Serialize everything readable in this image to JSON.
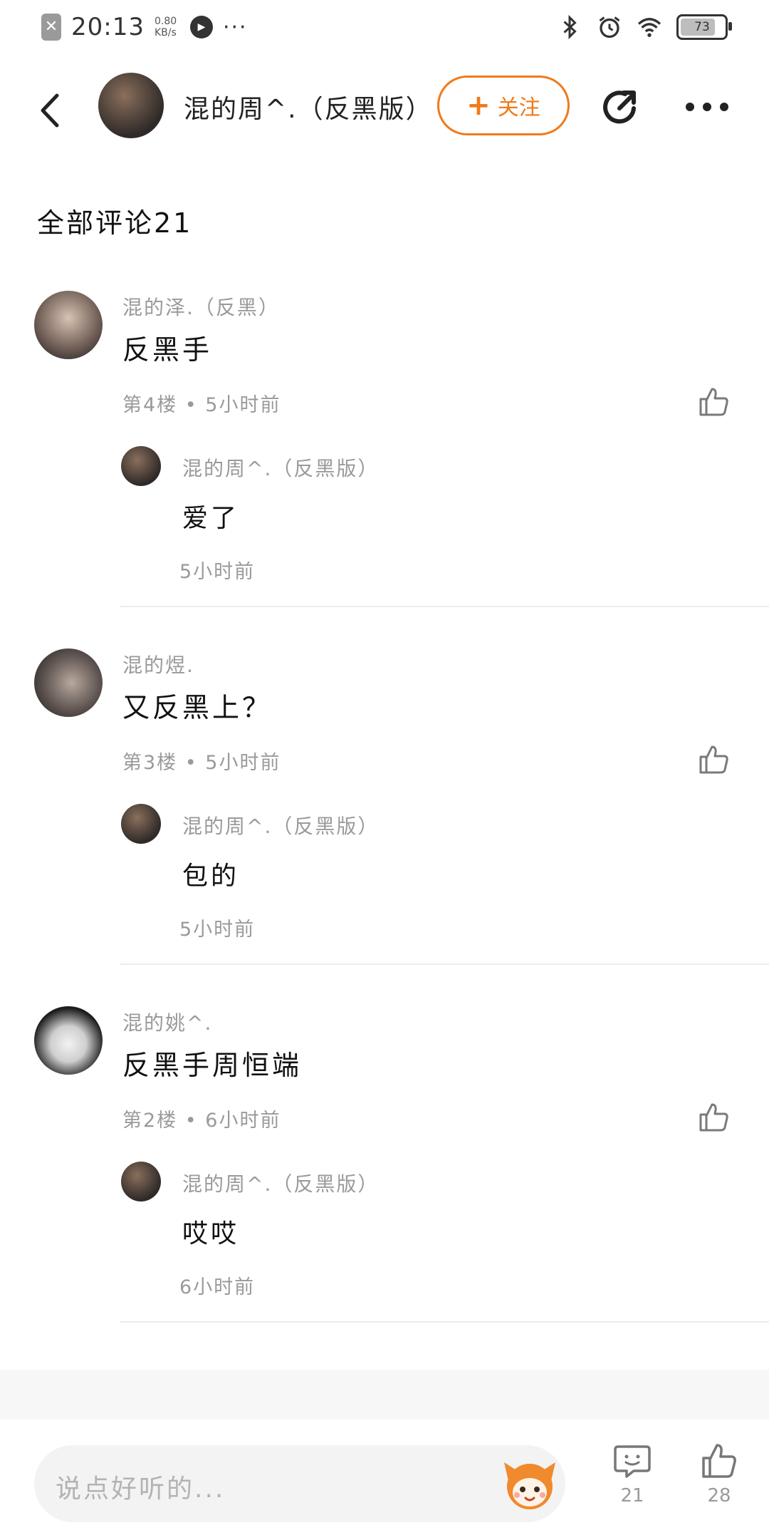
{
  "status_bar": {
    "time": "20:13",
    "net_rate_value": "0.80",
    "net_rate_unit": "KB/s",
    "battery": "73",
    "overflow": "···"
  },
  "header": {
    "title": "混的周^.（反黑版）",
    "follow_label": "关注",
    "follow_plus": "+"
  },
  "section_title": "全部评论21",
  "comments": [
    {
      "user": "混的泽.（反黑）",
      "text": "反黑手",
      "meta": "第4楼 • 5小时前",
      "reply": {
        "user": "混的周^.（反黑版）",
        "text": "爱了",
        "time": "5小时前"
      }
    },
    {
      "user": "混的煜.",
      "text": "又反黑上？",
      "meta": "第3楼 • 5小时前",
      "reply": {
        "user": "混的周^.（反黑版）",
        "text": "包的",
        "time": "5小时前"
      }
    },
    {
      "user": "混的姚^.",
      "text": "反黑手周恒端",
      "meta": "第2楼 • 6小时前",
      "reply": {
        "user": "混的周^.（反黑版）",
        "text": "哎哎",
        "time": "6小时前"
      }
    }
  ],
  "bottom_bar": {
    "input_placeholder": "说点好听的...",
    "comment_count": "21",
    "like_count": "28"
  },
  "colors": {
    "accent": "#f07a1a",
    "meta_gray": "#9a9a9a",
    "divider": "#ececec"
  }
}
